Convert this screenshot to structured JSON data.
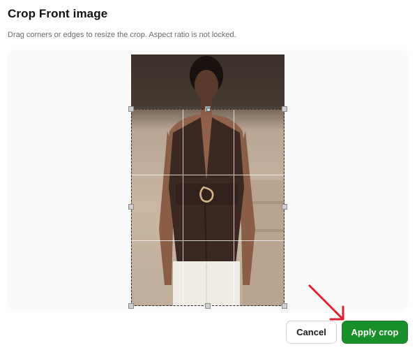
{
  "dialog": {
    "title": "Crop Front image",
    "subtitle": "Drag corners or edges to resize the crop. Aspect ratio is not locked."
  },
  "image": {
    "description_icon": "image-preview"
  },
  "actions": {
    "cancel_label": "Cancel",
    "apply_label": "Apply crop"
  },
  "colors": {
    "apply": "#19902a",
    "arrow": "#e02030"
  }
}
